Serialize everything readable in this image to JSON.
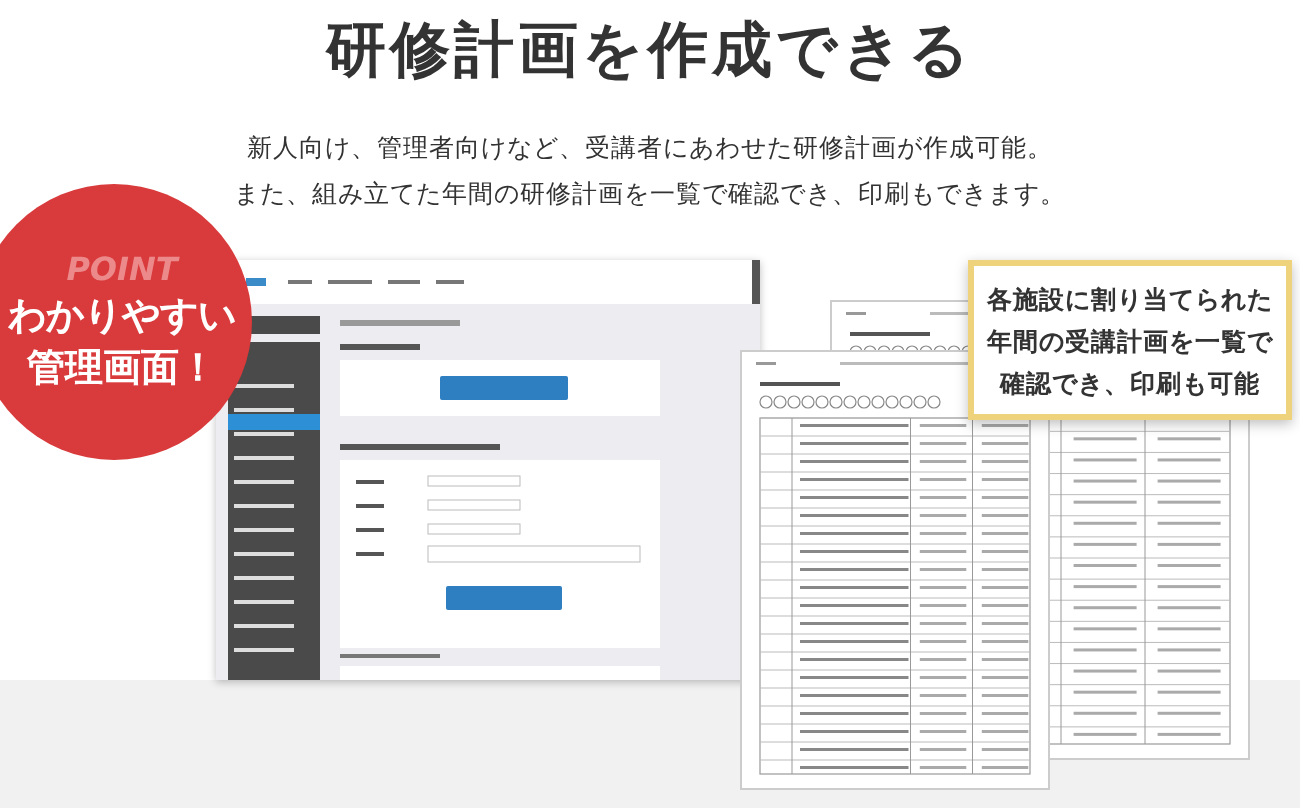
{
  "title": "研修計画を作成できる",
  "description": [
    "新人向け、管理者向けなど、受講者にあわせた研修計画が作成可能。",
    "また、組み立てた年間の研修計画を一覧で確認でき、印刷もできます。"
  ],
  "badge": {
    "label": "POINT",
    "lines": [
      "わかりやすい",
      "管理画面！"
    ]
  },
  "callout": {
    "lines": [
      "各施設に割り当てられた",
      "年間の受講計画を一覧で",
      "確認でき、印刷も可能"
    ]
  }
}
